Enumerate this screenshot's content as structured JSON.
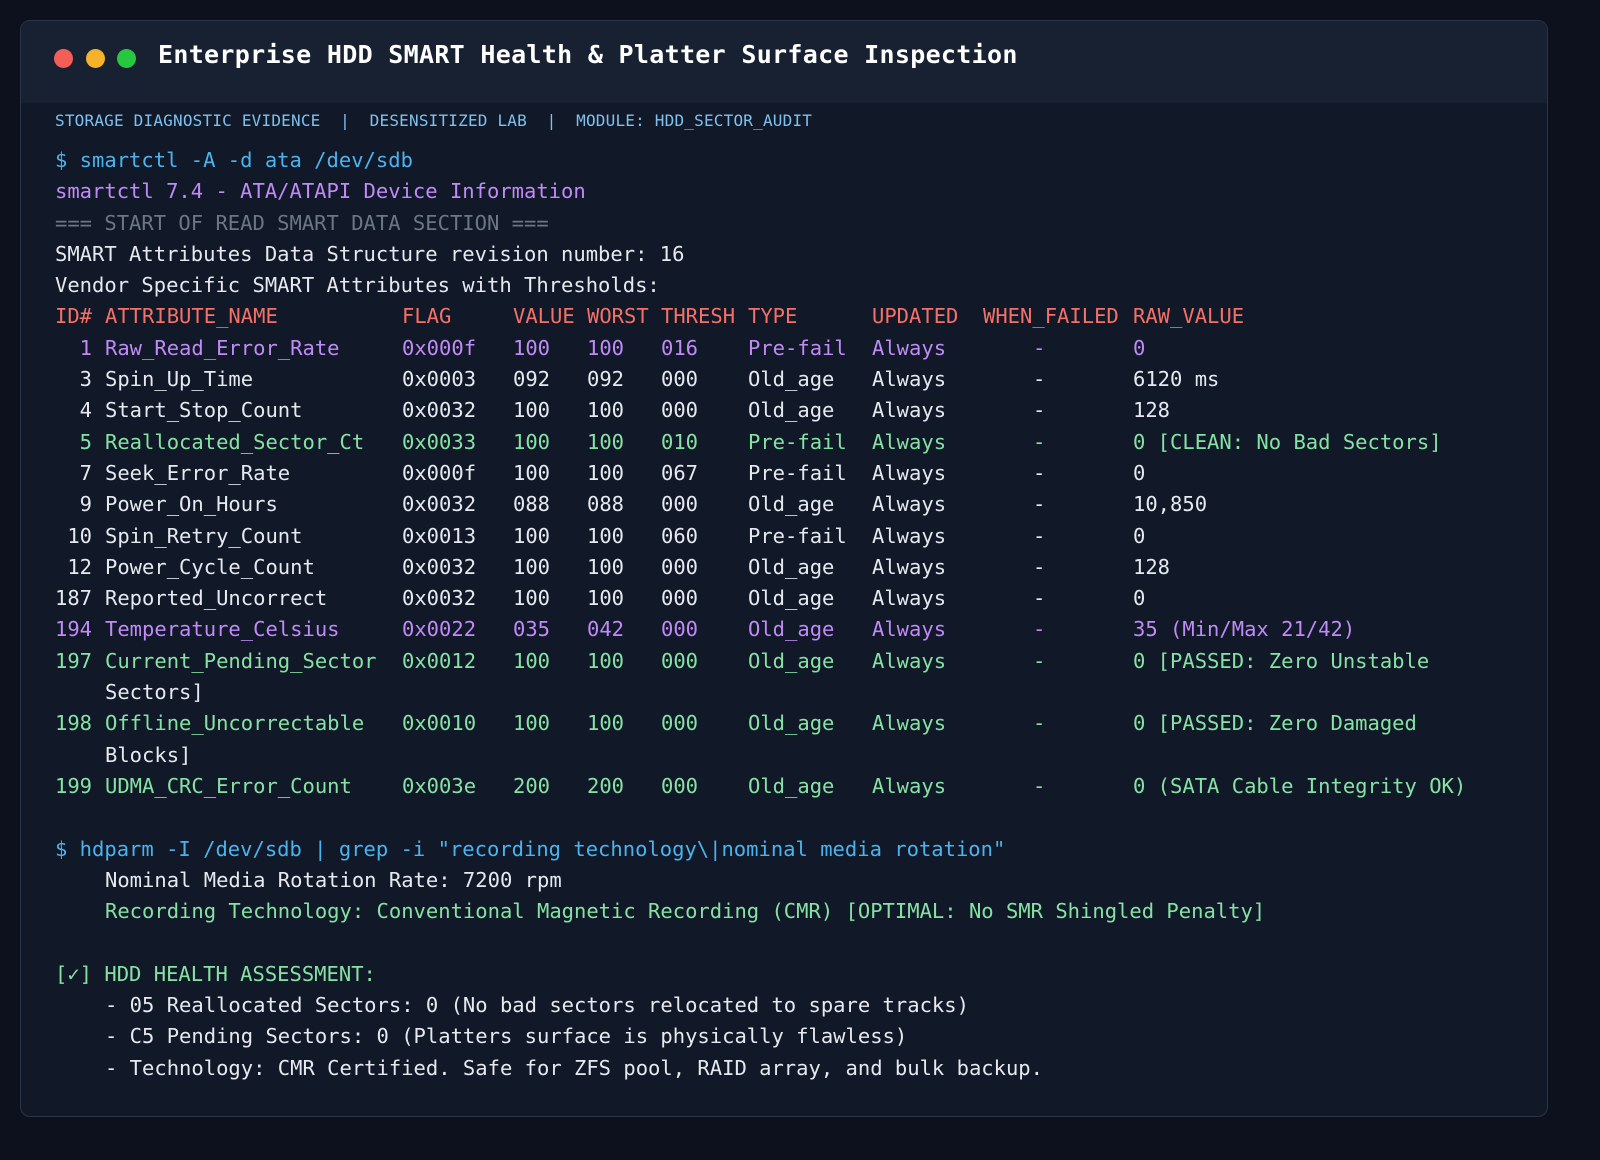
{
  "window": {
    "title": "Enterprise HDD SMART Health & Platter Surface Inspection"
  },
  "subheader": "STORAGE DIAGNOSTIC EVIDENCE  |  DESENSITIZED LAB  |  MODULE: HDD_SECTOR_AUDIT",
  "smart": {
    "command": "$ smartctl -A -d ata /dev/sdb",
    "version": "smartctl 7.4 - ATA/ATAPI Device Information",
    "section": "=== START OF READ SMART DATA SECTION ===",
    "revision": "SMART Attributes Data Structure revision number: 16",
    "vendor": "Vendor Specific SMART Attributes with Thresholds:",
    "headers": {
      "id": "ID#",
      "name": "ATTRIBUTE_NAME",
      "flag": "FLAG",
      "value": "VALUE",
      "worst": "WORST",
      "thresh": "THRESH",
      "type": "TYPE",
      "updated": "UPDATED",
      "when_failed": "WHEN_FAILED",
      "raw": "RAW_VALUE"
    },
    "rows": [
      {
        "id": "1",
        "name": "Raw_Read_Error_Rate",
        "flag": "0x000f",
        "value": "100",
        "worst": "100",
        "thresh": "016",
        "type": "Pre-fail",
        "updated": "Always",
        "when_failed": "-",
        "raw": "0",
        "raw_cont": ""
      },
      {
        "id": "3",
        "name": "Spin_Up_Time",
        "flag": "0x0003",
        "value": "092",
        "worst": "092",
        "thresh": "000",
        "type": "Old_age",
        "updated": "Always",
        "when_failed": "-",
        "raw": "6120 ms",
        "raw_cont": ""
      },
      {
        "id": "4",
        "name": "Start_Stop_Count",
        "flag": "0x0032",
        "value": "100",
        "worst": "100",
        "thresh": "000",
        "type": "Old_age",
        "updated": "Always",
        "when_failed": "-",
        "raw": "128",
        "raw_cont": ""
      },
      {
        "id": "5",
        "name": "Reallocated_Sector_Ct",
        "flag": "0x0033",
        "value": "100",
        "worst": "100",
        "thresh": "010",
        "type": "Pre-fail",
        "updated": "Always",
        "when_failed": "-",
        "raw": "0 [CLEAN: No Bad Sectors]",
        "raw_cont": ""
      },
      {
        "id": "7",
        "name": "Seek_Error_Rate",
        "flag": "0x000f",
        "value": "100",
        "worst": "100",
        "thresh": "067",
        "type": "Pre-fail",
        "updated": "Always",
        "when_failed": "-",
        "raw": "0",
        "raw_cont": ""
      },
      {
        "id": "9",
        "name": "Power_On_Hours",
        "flag": "0x0032",
        "value": "088",
        "worst": "088",
        "thresh": "000",
        "type": "Old_age",
        "updated": "Always",
        "when_failed": "-",
        "raw": "10,850",
        "raw_cont": ""
      },
      {
        "id": "10",
        "name": "Spin_Retry_Count",
        "flag": "0x0013",
        "value": "100",
        "worst": "100",
        "thresh": "060",
        "type": "Pre-fail",
        "updated": "Always",
        "when_failed": "-",
        "raw": "0",
        "raw_cont": ""
      },
      {
        "id": "12",
        "name": "Power_Cycle_Count",
        "flag": "0x0032",
        "value": "100",
        "worst": "100",
        "thresh": "000",
        "type": "Old_age",
        "updated": "Always",
        "when_failed": "-",
        "raw": "128",
        "raw_cont": ""
      },
      {
        "id": "187",
        "name": "Reported_Uncorrect",
        "flag": "0x0032",
        "value": "100",
        "worst": "100",
        "thresh": "000",
        "type": "Old_age",
        "updated": "Always",
        "when_failed": "-",
        "raw": "0",
        "raw_cont": ""
      },
      {
        "id": "194",
        "name": "Temperature_Celsius",
        "flag": "0x0022",
        "value": "035",
        "worst": "042",
        "thresh": "000",
        "type": "Old_age",
        "updated": "Always",
        "when_failed": "-",
        "raw": "35 (Min/Max 21/42)",
        "raw_cont": ""
      },
      {
        "id": "197",
        "name": "Current_Pending_Sector",
        "flag": "0x0012",
        "value": "100",
        "worst": "100",
        "thresh": "000",
        "type": "Old_age",
        "updated": "Always",
        "when_failed": "-",
        "raw": "0 [PASSED: Zero Unstable",
        "raw_cont": "Sectors]"
      },
      {
        "id": "198",
        "name": "Offline_Uncorrectable",
        "flag": "0x0010",
        "value": "100",
        "worst": "100",
        "thresh": "000",
        "type": "Old_age",
        "updated": "Always",
        "when_failed": "-",
        "raw": "0 [PASSED: Zero Damaged",
        "raw_cont": "Blocks]"
      },
      {
        "id": "199",
        "name": "UDMA_CRC_Error_Count",
        "flag": "0x003e",
        "value": "200",
        "worst": "200",
        "thresh": "000",
        "type": "Old_age",
        "updated": "Always",
        "when_failed": "-",
        "raw": "0 (SATA Cable Integrity OK)",
        "raw_cont": ""
      }
    ]
  },
  "hdparm": {
    "command": "$ hdparm -I /dev/sdb | grep -i \"recording technology\\|nominal media rotation\"",
    "rotation": "Nominal Media Rotation Rate: 7200 rpm",
    "recording": "Recording Technology: Conventional Magnetic Recording (CMR) [OPTIMAL: No SMR Shingled Penalty]"
  },
  "assessment": {
    "title": "[✓] HDD HEALTH ASSESSMENT:",
    "items": [
      "- 05 Reallocated Sectors: 0 (No bad sectors relocated to spare tracks)",
      "- C5 Pending Sectors: 0 (Platters surface is physically flawless)",
      "- Technology: CMR Certified. Safe for ZFS pool, RAID array, and bulk backup."
    ]
  },
  "colors": {
    "background": "#0c111d",
    "panel": "#111827",
    "titlebar": "#172131",
    "command": "#4cb3ee",
    "info": "#c08af7",
    "header": "#f57167",
    "pass": "#86e2a3",
    "text": "#e6e9ef"
  }
}
